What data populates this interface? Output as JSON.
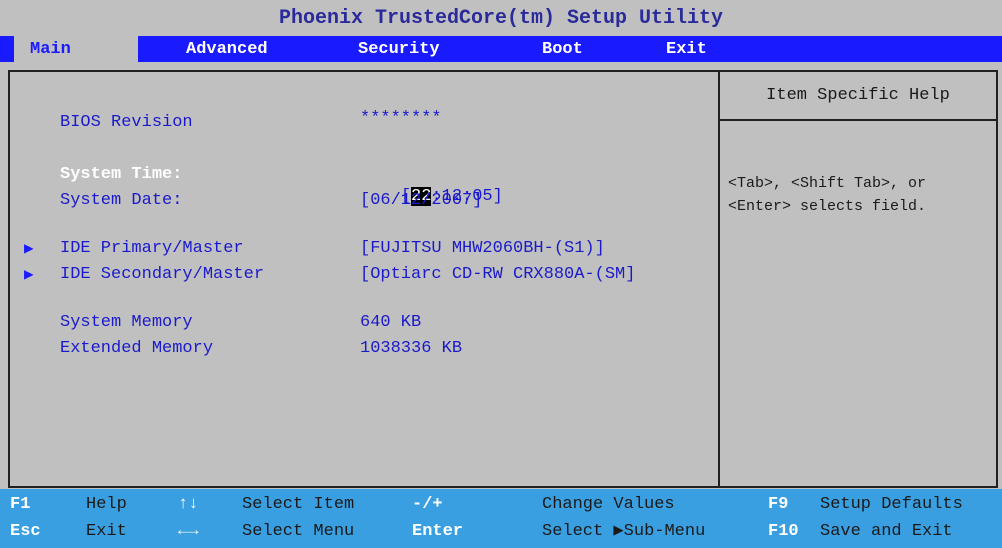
{
  "title": "Phoenix TrustedCore(tm) Setup Utility",
  "menu": {
    "tabs": [
      {
        "label": "Main"
      },
      {
        "label": "Advanced"
      },
      {
        "label": "Security"
      },
      {
        "label": "Boot"
      },
      {
        "label": "Exit"
      }
    ],
    "active_tab": "Main"
  },
  "main": {
    "bios_revision": {
      "label": "BIOS Revision",
      "value": "********"
    },
    "system_time": {
      "label": "System Time:",
      "open_bracket": "[",
      "hour": "22",
      "rest": ":12:05]"
    },
    "system_date": {
      "label": "System Date:",
      "value": "[06/12/2007]"
    },
    "ide_primary": {
      "label": "IDE Primary/Master",
      "value": "[FUJITSU MHW2060BH-(S1)]"
    },
    "ide_secondary": {
      "label": "IDE Secondary/Master",
      "value": "[Optiarc CD-RW CRX880A-(SM]"
    },
    "system_memory": {
      "label": "System Memory",
      "value": "640 KB"
    },
    "extended_memory": {
      "label": "Extended Memory",
      "value": "1038336 KB"
    }
  },
  "help": {
    "title": "Item Specific Help",
    "text": "<Tab>, <Shift Tab>, or\n<Enter> selects field."
  },
  "footer": {
    "f1_key": "F1",
    "f1_text": "Help",
    "esc_key": "Esc",
    "esc_text": "Exit",
    "updown_icon": "↑↓",
    "updown_text": "Select Item",
    "leftright_icon": "←→",
    "leftright_text": "Select Menu",
    "minusplus_key": "-/+",
    "minusplus_text": "Change Values",
    "enter_key": "Enter",
    "enter_text_a": "Select ",
    "enter_arrow": "▶",
    "enter_text_b": "Sub-Menu",
    "f9_key": "F9",
    "f9_text": "Setup Defaults",
    "f10_key": "F10",
    "f10_text": "Save and Exit"
  },
  "colors": {
    "background": "#c0c0c0",
    "menu_bar": "#1a1aff",
    "field_text": "#1a1acc",
    "footer": "#3a9fe0"
  }
}
